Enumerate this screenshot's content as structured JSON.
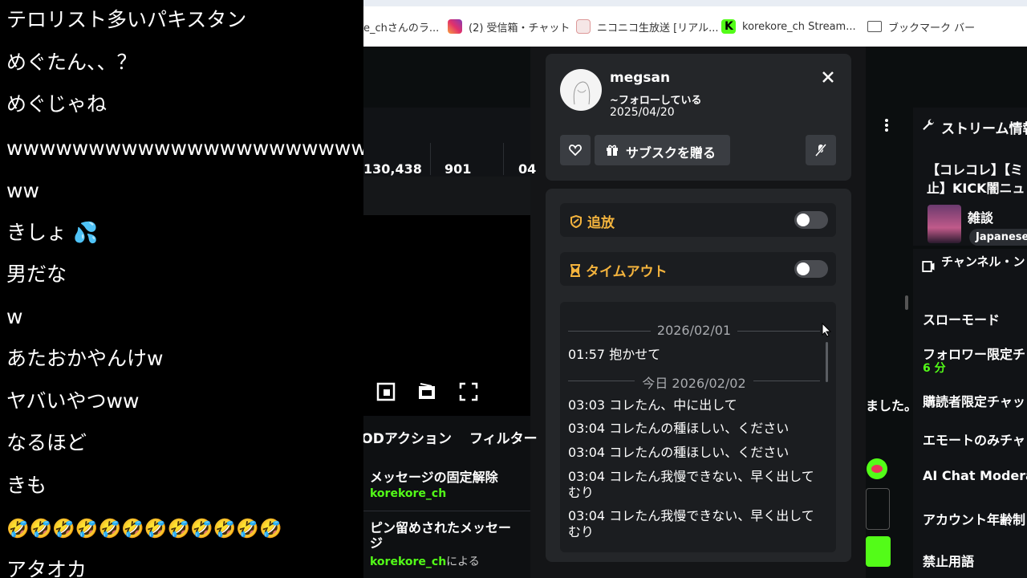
{
  "comments": [
    "テロリスト多いパキスタン",
    "めぐたん、、？",
    "めぐじゃね",
    "wwwwwwwwwwwwwwwwwwwwww",
    "ww",
    "きしょ 💦",
    "男だな",
    "w",
    "あたおかやんけw",
    "ヤバいやつww",
    "なるほど",
    "きも",
    "🤣🤣🤣🤣🤣🤣🤣🤣🤣🤣🤣🤣",
    "アタオカ"
  ],
  "bookmarks": [
    {
      "label": "e_chさんのラ...",
      "color": "#cccccc"
    },
    {
      "label": "(2) 受信箱・チャット",
      "color": "#e1306c"
    },
    {
      "label": "ニコニコ生放送 [リアル...",
      "color": "#e8e8e8"
    },
    {
      "label": "korekore_ch Stream...",
      "color": "#53fc18"
    },
    {
      "label": "ブックマーク バー",
      "color": "#ffffff"
    }
  ],
  "stats": {
    "viewers": "130,438",
    "count": "901",
    "partial": "04"
  },
  "tabs": {
    "mod_actions": "MODアクション",
    "filters": "フィルター"
  },
  "mod_log": [
    {
      "title": "メッセージの固定解除",
      "user": "korekore_ch",
      "suffix": ""
    },
    {
      "title": "ピン留めされたメッセージ",
      "user": "korekore_ch",
      "suffix": "による"
    }
  ],
  "stream_info": {
    "header": "ストリーム情報",
    "title": "【コレコレ】【ミ止】KICK闇ニュ",
    "category": "雑談",
    "language": "Japanese"
  },
  "channel_settings": {
    "header": "チャンネル・ン",
    "items": [
      {
        "label": "スローモード",
        "sub": ""
      },
      {
        "label": "フォロワー限定チ",
        "sub": "6 分"
      },
      {
        "label": "購読者限定チャッ",
        "sub": ""
      },
      {
        "label": "エモートのみチャ",
        "sub": ""
      },
      {
        "label": "AI Chat Moderat",
        "sub": ""
      },
      {
        "label": "アカウント年齢制",
        "sub": ""
      },
      {
        "label": "禁止用語",
        "sub": ""
      }
    ]
  },
  "partial_text": "ました。",
  "user_card": {
    "username": "megsan",
    "follow_status": "~フォローしている",
    "follow_date": "2025/04/20",
    "gift_sub_label": "サブスクを贈る",
    "ban_label": "追放",
    "timeout_label": "タイムアウト"
  },
  "history": {
    "date1": "2026/02/01",
    "date2": "今日 2026/02/02",
    "messages": [
      "01:57 抱かせて",
      "03:03 コレたん、中に出して",
      "03:04 コレたんの種ほしい、ください",
      "03:04 コレたんの種ほしい、ください",
      "03:04 コレたん我慢できない、早く出してむり",
      "03:04 コレたん我慢できない、早く出してむり"
    ]
  },
  "colors": {
    "kick_green": "#53fc18",
    "warning": "#f3b33d",
    "panel": "#242629"
  }
}
